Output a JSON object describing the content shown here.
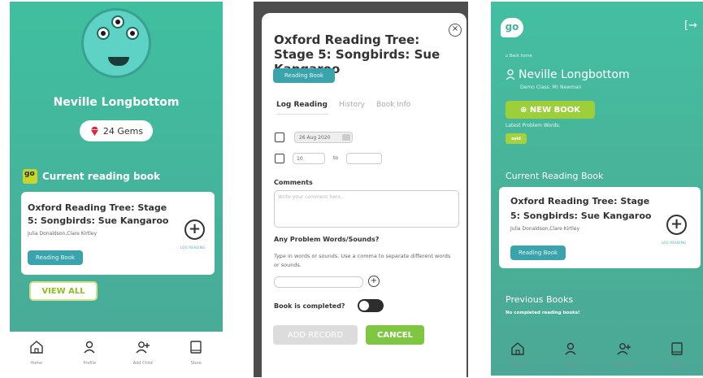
{
  "colors": {
    "teal": "#45b39c",
    "lime": "#9ccf3a",
    "button_blue": "#3aa3ab",
    "dark": "#333333"
  },
  "profile": {
    "name": "Neville Longbottom",
    "gems": "24 Gems",
    "current_reading_heading": "Current reading book",
    "book": {
      "title_line1": "Oxford Reading Tree: Stage",
      "title_line2": "5: Songbirds: Sue Kangaroo",
      "authors": "Julia Donaldson,Clare Kirtley",
      "type_label": "Reading Book",
      "log_label": "LOG READING"
    },
    "view_all_label": "VIEW ALL"
  },
  "nav": {
    "home": "Home",
    "profile": "Profile",
    "add_child": "Add Child",
    "store": "Store"
  },
  "log_modal": {
    "title": "Oxford Reading Tree: Stage 5: Songbirds: Sue Kangaroo",
    "type_label": "Reading Book",
    "tabs": [
      "Log Reading",
      "History",
      "Book Info"
    ],
    "date": "26 Aug 2020",
    "page_from": "10",
    "to_label": "to",
    "page_to": "",
    "comments_label": "Comments",
    "comments_placeholder": "Write your comment here...",
    "problem_label": "Any Problem Words/Sounds?",
    "problem_help": "Type in words or sounds. Use a comma to separate different words or sounds.",
    "completed_label": "Book is completed?",
    "add_record_label": "ADD RECORD",
    "cancel_label": "CANCEL"
  },
  "child_page": {
    "logo_text": "go",
    "back_home": "Back home",
    "name": "Neville Longbottom",
    "class_info": "Demo Class: Mr Newman",
    "new_book_label": "NEW BOOK",
    "latest_problem_label": "Latest Problem Words:",
    "problem_word": "said",
    "current_heading": "Current Reading Book",
    "previous_heading": "Previous Books",
    "no_previous": "No completed reading books!"
  }
}
